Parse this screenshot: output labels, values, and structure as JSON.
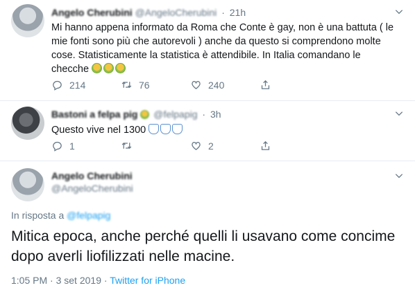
{
  "tweets": [
    {
      "name": "Angelo Cherubini",
      "handle": "@AngeloCherubini",
      "time": "21h",
      "text": "Mi hanno appena informato da Roma che Conte è gay, non  è una battuta ( le mie fonti sono più che autorevoli ) anche da questo si comprendono molte cose. Statisticamente la statistica è attendibile. In Italia comandano le checche",
      "emojis": [
        "sick-face",
        "sick-face",
        "sick-face"
      ],
      "replies": "214",
      "retweets": "76",
      "likes": "240"
    },
    {
      "name": "Bastoni a felpa pig",
      "handle": "@felpapig",
      "time": "3h",
      "text": "Questo vive nel 1300",
      "emojis": [
        "facepalm",
        "facepalm",
        "facepalm"
      ],
      "replies": "1",
      "retweets": "",
      "likes": "2"
    }
  ],
  "main": {
    "name": "Angelo Cherubini",
    "handle": "@AngeloCherubini",
    "reply_prefix": "In risposta a",
    "reply_handle": "@felpapig",
    "text": "Mitica epoca, anche perché quelli li usavano come concime dopo averli liofilizzati nelle macine.",
    "time": "1:05 PM",
    "date": "3 set 2019",
    "source": "Twitter for iPhone"
  },
  "colors": {
    "accent": "#1da1f2",
    "secondary_text": "#657786",
    "divider": "#e6ecf0"
  },
  "icons": [
    "chevron-down-icon",
    "reply-icon",
    "retweet-icon",
    "like-icon",
    "share-icon"
  ]
}
